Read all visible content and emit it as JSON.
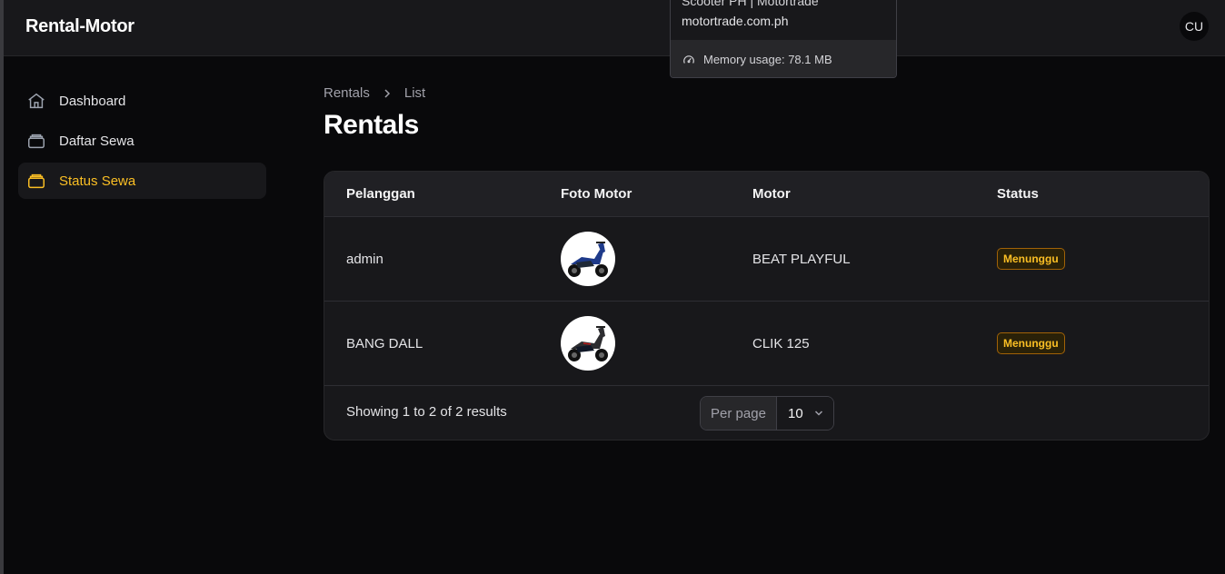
{
  "app": {
    "title": "Rental-Motor",
    "avatar_initials": "CU"
  },
  "tooltip": {
    "line1": "Scooter PH | Motortrade",
    "line2": "motortrade.com.ph",
    "memory": "Memory usage: 78.1 MB"
  },
  "sidebar": {
    "items": [
      {
        "label": "Dashboard",
        "icon": "home-icon",
        "active": false
      },
      {
        "label": "Daftar Sewa",
        "icon": "archive-icon",
        "active": false
      },
      {
        "label": "Status Sewa",
        "icon": "archive-icon",
        "active": true
      }
    ]
  },
  "breadcrumb": {
    "parent": "Rentals",
    "current": "List"
  },
  "page": {
    "title": "Rentals"
  },
  "table": {
    "headers": [
      "Pelanggan",
      "Foto Motor",
      "Motor",
      "Status"
    ],
    "rows": [
      {
        "pelanggan": "admin",
        "motor": "BEAT PLAYFUL",
        "status": "Menunggu",
        "photo_color": "#1e3a8a"
      },
      {
        "pelanggan": "BANG DALL",
        "motor": "CLIK 125",
        "status": "Menunggu",
        "photo_color": "#1f2937"
      }
    ]
  },
  "pagination": {
    "summary": "Showing 1 to 2 of 2 results",
    "per_page_label": "Per page",
    "per_page_value": "10"
  },
  "colors": {
    "accent": "#fbbf24",
    "background": "#09090b",
    "surface": "#18181b"
  }
}
